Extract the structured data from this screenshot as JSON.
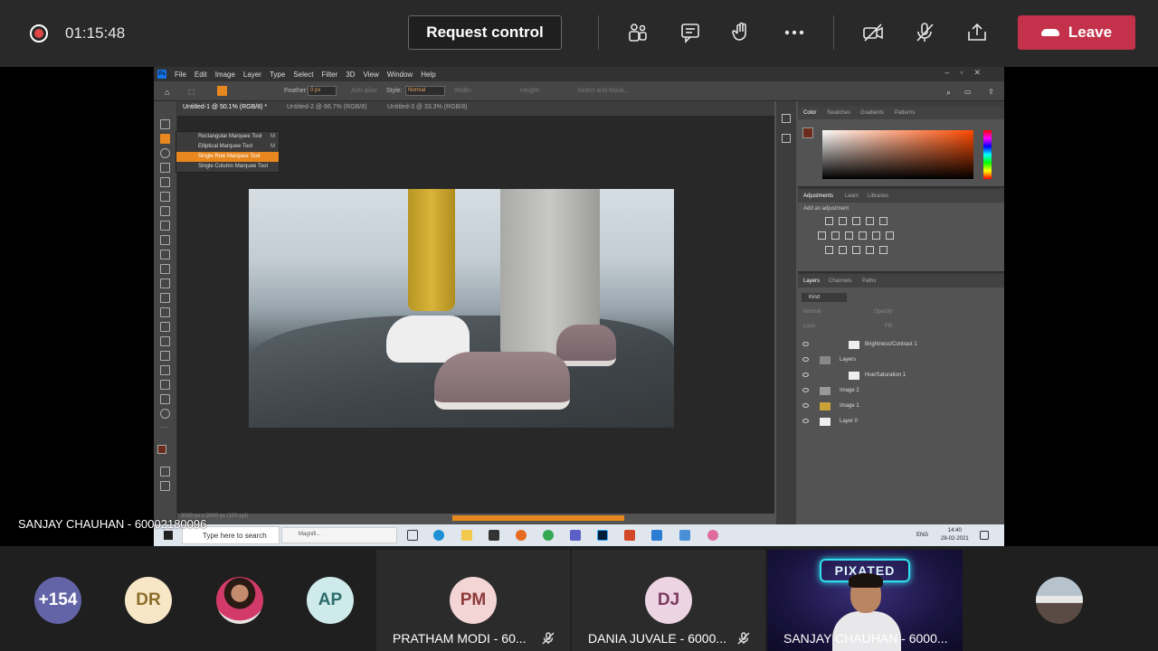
{
  "meeting": {
    "timer": "01:15:48",
    "request_control_label": "Request control",
    "leave_label": "Leave",
    "colors": {
      "leave": "#c4314b",
      "recording": "#e04646"
    }
  },
  "presenter_label": "SANJAY CHAUHAN - 60002180096",
  "photoshop": {
    "menu": [
      "File",
      "Edit",
      "Image",
      "Layer",
      "Type",
      "Select",
      "Filter",
      "3D",
      "View",
      "Window",
      "Help"
    ],
    "options": {
      "feather_label": "Feather:",
      "feather_value": "0 px",
      "anti_alias": "Anti-alias",
      "style_label": "Style:",
      "style_value": "Normal",
      "width_label": "Width:",
      "height_label": "Height:",
      "select_mask": "Select and Mask..."
    },
    "tabs": [
      "Untitled-1 @ 50.1% (RGB/8) *",
      "Untitled-2 @ 66.7% (RGB/8)",
      "Untitled-3 @ 33.3% (RGB/8)"
    ],
    "flyout": [
      {
        "label": "Rectangular Marquee Tool",
        "key": "M"
      },
      {
        "label": "Elliptical Marquee Tool",
        "key": "M"
      },
      {
        "label": "Single Row Marquee Tool",
        "key": ""
      },
      {
        "label": "Single Column Marquee Tool",
        "key": ""
      }
    ],
    "status": "3000 px x 2000 px (150 ppi)",
    "color_panel_tabs": [
      "Color",
      "Swatches",
      "Gradients",
      "Patterns"
    ],
    "adjust_panel_tabs": [
      "Adjustments",
      "Learn",
      "Libraries"
    ],
    "add_adjustment": "Add an adjustment",
    "layers_panel_tabs": [
      "Layers",
      "Channels",
      "Paths"
    ],
    "layers_kind": "Kind",
    "layers_blend": "Normal",
    "layers_opacity": "Opacity:",
    "layers_lock": "Lock:",
    "layers_fill": "Fill:",
    "layers": [
      "Brightness/Contrast 1",
      "Layers",
      "Hue/Saturation 1",
      "Image 2",
      "Image 1",
      "Layer 0"
    ]
  },
  "taskbar": {
    "search_placeholder": "Type here to search",
    "magnifier": "Magnifi...",
    "lang": "ENG",
    "time": "14:40",
    "date": "28-02-2021"
  },
  "participants": {
    "overflow": "+154",
    "p1": "DR",
    "p2": "AP",
    "tile1_initials": "PM",
    "tile1_name": "PRATHAM MODI - 60...",
    "tile2_initials": "DJ",
    "tile2_name": "DANIA JUVALE - 6000...",
    "tile3_name": "SANJAY CHAUHAN - 6000...",
    "neon_text": "PIXATED"
  }
}
